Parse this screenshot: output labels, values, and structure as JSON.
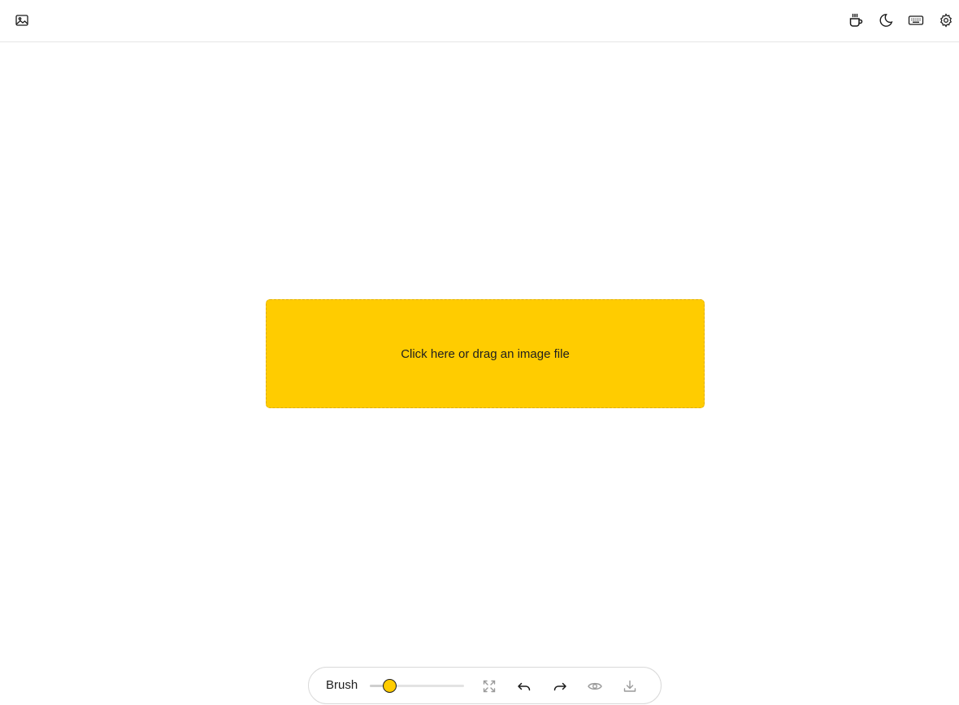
{
  "header": {
    "left_icon": "image-icon",
    "right_icons": [
      "coffee-icon",
      "moon-icon",
      "keyboard-icon",
      "gear-icon"
    ]
  },
  "dropzone": {
    "text": "Click here or drag an image file",
    "color": "#ffcc00"
  },
  "toolbar": {
    "brush_label": "Brush",
    "brush_size_fraction": 0.21,
    "icons": [
      "fullscreen-icon",
      "undo-icon",
      "redo-icon",
      "eye-icon",
      "download-icon"
    ]
  },
  "colors": {
    "accent": "#ffcc00",
    "border": "#e6e6e6",
    "icon": "#1a1a1a",
    "icon_muted": "#9a9a9a"
  }
}
